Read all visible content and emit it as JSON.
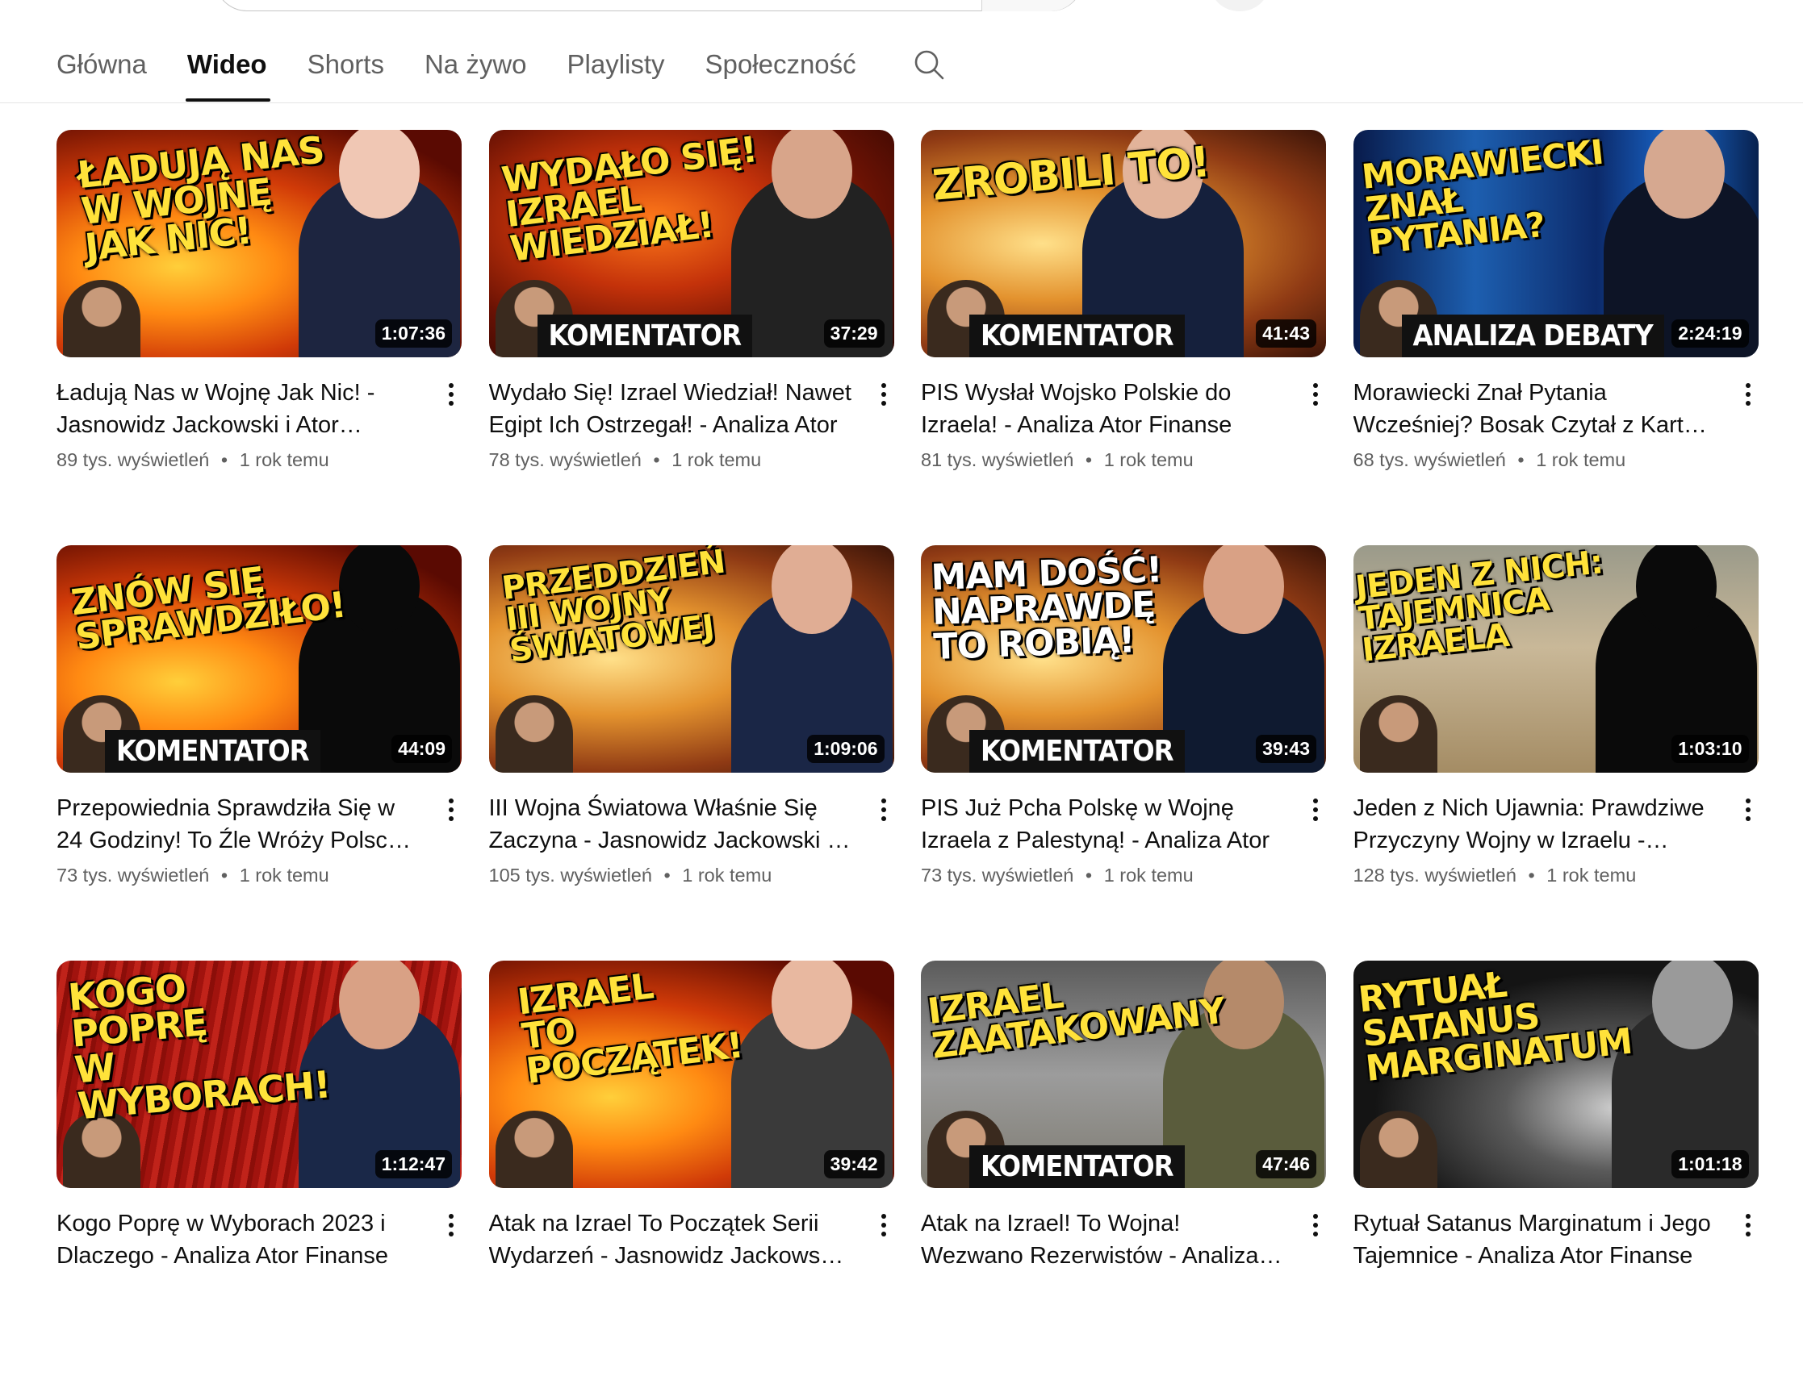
{
  "tabs": [
    {
      "label": "Główna",
      "active": false
    },
    {
      "label": "Wideo",
      "active": true
    },
    {
      "label": "Shorts",
      "active": false
    },
    {
      "label": "Na żywo",
      "active": false
    },
    {
      "label": "Playlisty",
      "active": false
    },
    {
      "label": "Społeczność",
      "active": false
    }
  ],
  "tab_search_icon": "search-icon",
  "videos": [
    {
      "title": "Ładują Nas w Wojnę Jak Nic! - Jasnowidz Jackowski i Ator Finanse",
      "views": "89 tys. wyświetleń",
      "age": "1 rok temu",
      "duration": "1:07:36",
      "thumb_text": "ŁADUJĄ NAS\nW WOJNĘ\nJAK NIC!",
      "thumb_label": ""
    },
    {
      "title": "Wydało Się! Izrael Wiedział! Nawet Egipt Ich Ostrzegał! - Analiza Ator",
      "views": "78 tys. wyświetleń",
      "age": "1 rok temu",
      "duration": "37:29",
      "thumb_text": "WYDAŁO SIĘ!\nIZRAEL\nWIEDZIAŁ!",
      "thumb_label": "KOMENTATOR"
    },
    {
      "title": "PIS Wysłał Wojsko Polskie do Izraela! - Analiza Ator Finanse",
      "views": "81 tys. wyświetleń",
      "age": "1 rok temu",
      "duration": "41:43",
      "thumb_text": "ZROBILI TO!",
      "thumb_label": "KOMENTATOR"
    },
    {
      "title": "Morawiecki Znał Pytania Wcześniej? Bosak Czytał z Kartki! - Analiza Ator",
      "views": "68 tys. wyświetleń",
      "age": "1 rok temu",
      "duration": "2:24:19",
      "thumb_text": "MORAWIECKI\nZNAŁ\nPYTANIA?",
      "thumb_label": "ANALIZA DEBATY"
    },
    {
      "title": "Przepowiednia Sprawdziła Się w 24 Godziny! To Źle Wróży Polsce - Analiza Ator",
      "views": "73 tys. wyświetleń",
      "age": "1 rok temu",
      "duration": "44:09",
      "thumb_text": "ZNÓW SIĘ\nSPRAWDZIŁO!",
      "thumb_label": "KOMENTATOR"
    },
    {
      "title": "III Wojna Światowa Właśnie Się Zaczyna - Jasnowidz Jackowski i Ator",
      "views": "105 tys. wyświetleń",
      "age": "1 rok temu",
      "duration": "1:09:06",
      "thumb_text": "PRZEDDZIEŃ\nIII WOJNY\nŚWIATOWEJ",
      "thumb_label": ""
    },
    {
      "title": "PIS Już Pcha Polskę w Wojnę Izraela z Palestyną! - Analiza Ator",
      "views": "73 tys. wyświetleń",
      "age": "1 rok temu",
      "duration": "39:43",
      "thumb_text": "MAM DOŚĆ!\nNAPRAWDĘ\nTO ROBIĄ!",
      "thumb_label": "KOMENTATOR"
    },
    {
      "title": "Jeden z Nich Ujawnia: Prawdziwe Przyczyny Wojny w Izraelu - Analiza Ator",
      "views": "128 tys. wyświetleń",
      "age": "1 rok temu",
      "duration": "1:03:10",
      "thumb_text": "JEDEN Z NICH:\nTAJEMNICA\nIZRAELA",
      "thumb_label": ""
    },
    {
      "title": "Kogo Poprę w Wyborach 2023 i Dlaczego - Analiza Ator Finanse",
      "views": "",
      "age": "",
      "duration": "1:12:47",
      "thumb_text": "KOGO\nPOPRĘ\nW\nWYBORACH!",
      "thumb_label": ""
    },
    {
      "title": "Atak na Izrael To Początek Serii Wydarzeń - Jasnowidz Jackowski i Ator",
      "views": "",
      "age": "",
      "duration": "39:42",
      "thumb_text": "IZRAEL\nTO\nPOCZĄTEK!",
      "thumb_label": ""
    },
    {
      "title": "Atak na Izrael! To Wojna! Wezwano Rezerwistów - Analiza Ator",
      "views": "",
      "age": "",
      "duration": "47:46",
      "thumb_text": "IZRAEL\nZAATAKOWANY",
      "thumb_label": "KOMENTATOR"
    },
    {
      "title": "Rytuał Satanus Marginatum i Jego Tajemnice - Analiza Ator Finanse",
      "views": "",
      "age": "",
      "duration": "1:01:18",
      "thumb_text": "RYTUAŁ\nSATANUS\nMARGINATUM",
      "thumb_label": ""
    }
  ],
  "stats_separator": "•"
}
